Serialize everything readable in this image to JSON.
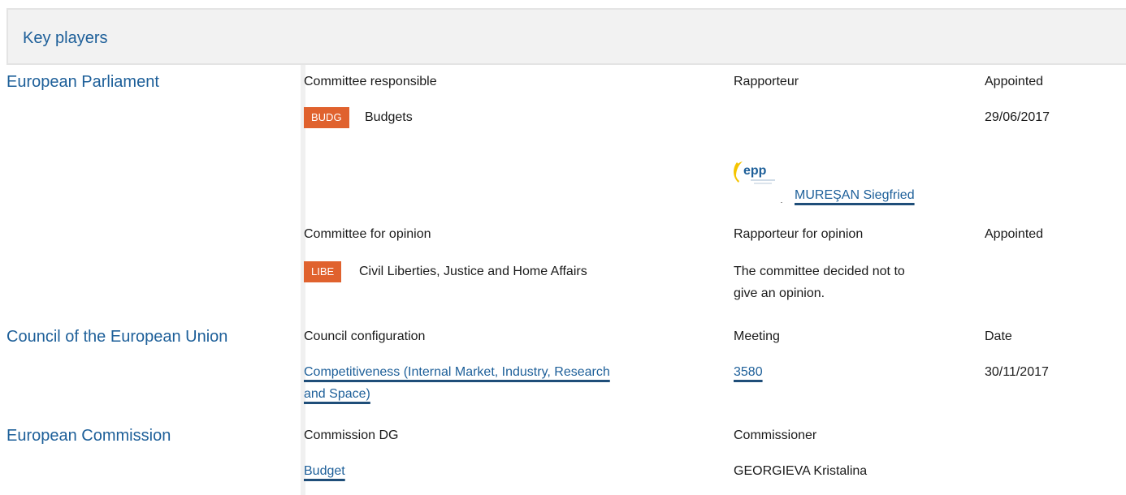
{
  "panel": {
    "title": "Key players"
  },
  "parliament": {
    "label": "European Parliament",
    "committee_header": "Committee responsible",
    "rapporteur_header": "Rapporteur",
    "appointed_header": "Appointed",
    "committee_badge": "BUDG",
    "committee_name": "Budgets",
    "appointed_date": "29/06/2017",
    "rapporteur_name": "MUREŞAN Siegfried",
    "group_logo_text": "epp",
    "opinion_header": "Committee for opinion",
    "opinion_rapporteur_header": "Rapporteur for opinion",
    "opinion_appointed_header": "Appointed",
    "opinion_badge": "LIBE",
    "opinion_committee_name": "Civil Liberties, Justice and Home Affairs",
    "opinion_note_line1": "The committee decided not to",
    "opinion_note_line2": "give an opinion."
  },
  "council": {
    "label": "Council of the European Union",
    "configuration_header": "Council configuration",
    "meeting_header": "Meeting",
    "date_header": "Date",
    "configuration_line1": "Competitiveness (Internal Market, Industry, Research",
    "configuration_line2": "and Space)",
    "meeting": "3580",
    "date": "30/11/2017"
  },
  "commission": {
    "label": "European Commission",
    "dg_header": "Commission DG",
    "commissioner_header": "Commissioner",
    "dg": "Budget",
    "commissioner": "GEORGIEVA Kristalina"
  },
  "colors": {
    "link": "#1d5f99",
    "badge": "#e0622e",
    "header_bg": "#f2f2f2"
  }
}
